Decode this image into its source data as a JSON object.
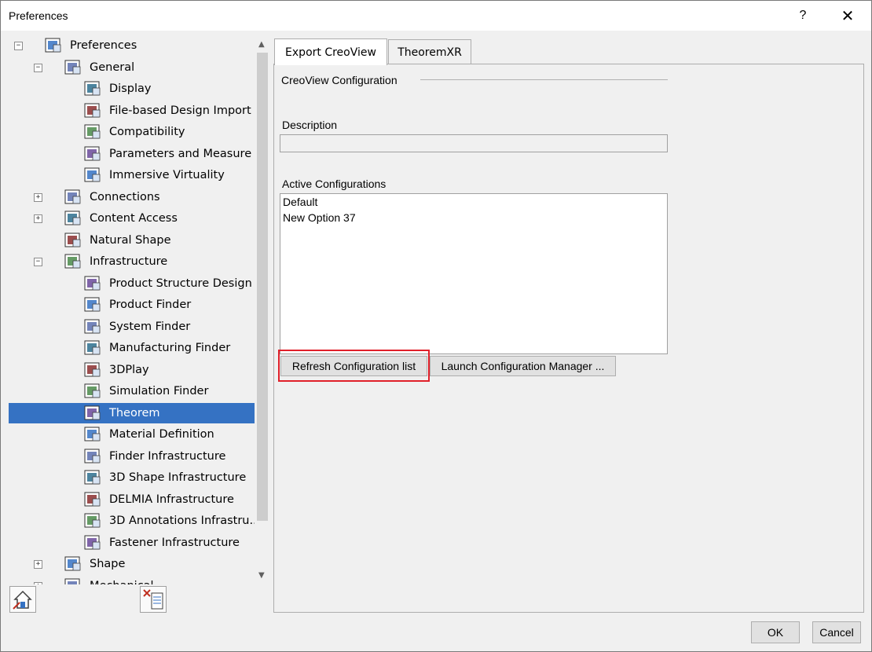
{
  "window": {
    "title": "Preferences",
    "help_label": "?",
    "close_label": "✕"
  },
  "tree": [
    {
      "label": "Preferences",
      "level": 0,
      "toggle": "−",
      "icon": "preferences-icon"
    },
    {
      "label": "General",
      "level": 1,
      "toggle": "−",
      "icon": "general-icon"
    },
    {
      "label": "Display",
      "level": 2,
      "icon": "display-icon"
    },
    {
      "label": "File-based Design Import",
      "level": 2,
      "icon": "file-import-icon"
    },
    {
      "label": "Compatibility",
      "level": 2,
      "icon": "compatibility-icon"
    },
    {
      "label": "Parameters and Measure",
      "level": 2,
      "icon": "parameters-icon"
    },
    {
      "label": "Immersive Virtuality",
      "level": 2,
      "icon": "immersive-icon"
    },
    {
      "label": "Connections",
      "level": 1,
      "toggle": "+",
      "icon": "connections-icon"
    },
    {
      "label": "Content Access",
      "level": 1,
      "toggle": "+",
      "icon": "content-access-icon"
    },
    {
      "label": "Natural Shape",
      "level": 1,
      "icon": "natural-shape-icon"
    },
    {
      "label": "Infrastructure",
      "level": 1,
      "toggle": "−",
      "icon": "infrastructure-icon"
    },
    {
      "label": "Product Structure Design",
      "level": 2,
      "icon": "product-structure-icon"
    },
    {
      "label": "Product Finder",
      "level": 2,
      "icon": "product-finder-icon"
    },
    {
      "label": "System Finder",
      "level": 2,
      "icon": "system-finder-icon"
    },
    {
      "label": "Manufacturing Finder",
      "level": 2,
      "icon": "manufacturing-finder-icon"
    },
    {
      "label": "3DPlay",
      "level": 2,
      "icon": "3dplay-icon"
    },
    {
      "label": "Simulation Finder",
      "level": 2,
      "icon": "simulation-finder-icon"
    },
    {
      "label": "Theorem",
      "level": 2,
      "icon": "theorem-icon",
      "selected": true
    },
    {
      "label": "Material Definition",
      "level": 2,
      "icon": "material-icon"
    },
    {
      "label": "Finder Infrastructure",
      "level": 2,
      "icon": "finder-infra-icon"
    },
    {
      "label": "3D Shape Infrastructure",
      "level": 2,
      "icon": "3d-shape-icon"
    },
    {
      "label": "DELMIA Infrastructure",
      "level": 2,
      "icon": "delmia-icon"
    },
    {
      "label": "3D Annotations Infrastru...",
      "level": 2,
      "icon": "annotations-icon"
    },
    {
      "label": "Fastener Infrastructure",
      "level": 2,
      "icon": "fastener-icon"
    },
    {
      "label": "Shape",
      "level": 1,
      "toggle": "+",
      "icon": "shape-icon"
    },
    {
      "label": "Mechanical",
      "level": 1,
      "toggle": "+",
      "icon": "mechanical-icon"
    }
  ],
  "tabs": [
    {
      "label": "Export CreoView",
      "active": true
    },
    {
      "label": "TheoremXR",
      "active": false
    }
  ],
  "panel": {
    "group_title": "CreoView Configuration",
    "description_label": "Description",
    "description_value": "",
    "active_label": "Active Configurations",
    "configurations": [
      "Default",
      "New Option 37"
    ],
    "refresh_button": "Refresh Configuration list",
    "launch_button": "Launch Configuration Manager ..."
  },
  "footer": {
    "ok_label": "OK",
    "cancel_label": "Cancel"
  },
  "colors": {
    "selection": "#3572c3",
    "highlight": "#e0202a"
  }
}
